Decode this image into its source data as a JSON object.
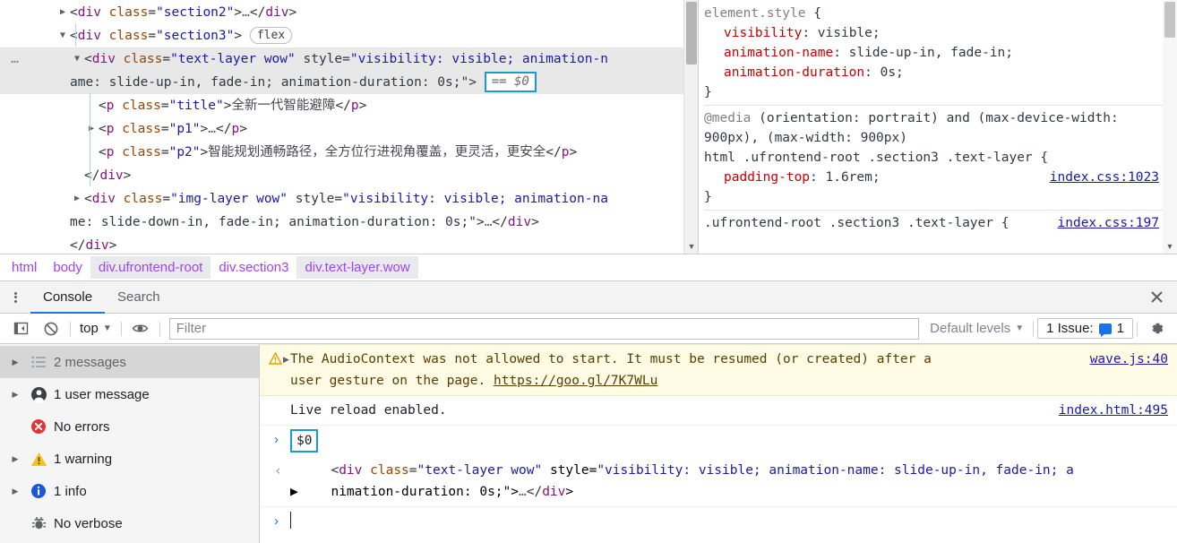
{
  "elements_panel": {
    "dom_tree": [
      {
        "indent": 1,
        "triangle": "collapsed",
        "segments": [
          {
            "t": "pn",
            "v": "<"
          },
          {
            "t": "tw",
            "v": "div"
          },
          {
            "t": "pn",
            "v": " "
          },
          {
            "t": "at",
            "v": "class"
          },
          {
            "t": "pn",
            "v": "="
          },
          {
            "t": "av",
            "v": "\"section2\""
          },
          {
            "t": "pn",
            "v": ">"
          },
          {
            "t": "el",
            "v": "…"
          },
          {
            "t": "pn",
            "v": "</"
          },
          {
            "t": "tw",
            "v": "div"
          },
          {
            "t": "pn",
            "v": ">"
          }
        ]
      },
      {
        "indent": 1,
        "triangle": "expanded",
        "segments": [
          {
            "t": "pn",
            "v": "<"
          },
          {
            "t": "tw",
            "v": "div"
          },
          {
            "t": "pn",
            "v": " "
          },
          {
            "t": "at",
            "v": "class"
          },
          {
            "t": "pn",
            "v": "="
          },
          {
            "t": "av",
            "v": "\"section3\""
          },
          {
            "t": "pn",
            "v": "> "
          }
        ],
        "badge_flex": "flex"
      },
      {
        "indent": 2,
        "triangle": "expanded",
        "selected": true,
        "ellipsis": "…",
        "line1": "<div class=\"text-layer wow\" style=\"visibility: visible; animation-n",
        "line2": "ame: slide-up-in, fade-in; animation-duration: 0s;\">",
        "badge_selected": "== $0"
      },
      {
        "indent": 3,
        "triangle": "none",
        "segments": [
          {
            "t": "pn",
            "v": "<"
          },
          {
            "t": "tw",
            "v": "p"
          },
          {
            "t": "pn",
            "v": " "
          },
          {
            "t": "at",
            "v": "class"
          },
          {
            "t": "pn",
            "v": "="
          },
          {
            "t": "av",
            "v": "\"title\""
          },
          {
            "t": "pn",
            "v": ">"
          },
          {
            "t": "tx",
            "v": "全新一代智能避障"
          },
          {
            "t": "pn",
            "v": "</"
          },
          {
            "t": "tw",
            "v": "p"
          },
          {
            "t": "pn",
            "v": ">"
          }
        ]
      },
      {
        "indent": 3,
        "triangle": "collapsed",
        "segments": [
          {
            "t": "pn",
            "v": "<"
          },
          {
            "t": "tw",
            "v": "p"
          },
          {
            "t": "pn",
            "v": " "
          },
          {
            "t": "at",
            "v": "class"
          },
          {
            "t": "pn",
            "v": "="
          },
          {
            "t": "av",
            "v": "\"p1\""
          },
          {
            "t": "pn",
            "v": ">"
          },
          {
            "t": "el",
            "v": "…"
          },
          {
            "t": "pn",
            "v": "</"
          },
          {
            "t": "tw",
            "v": "p"
          },
          {
            "t": "pn",
            "v": ">"
          }
        ]
      },
      {
        "indent": 3,
        "triangle": "none",
        "segments": [
          {
            "t": "pn",
            "v": "<"
          },
          {
            "t": "tw",
            "v": "p"
          },
          {
            "t": "pn",
            "v": " "
          },
          {
            "t": "at",
            "v": "class"
          },
          {
            "t": "pn",
            "v": "="
          },
          {
            "t": "av",
            "v": "\"p2\""
          },
          {
            "t": "pn",
            "v": ">"
          },
          {
            "t": "tx",
            "v": "智能规划通畅路径，全方位行进视角覆盖，更灵活，更安全"
          },
          {
            "t": "pn",
            "v": "</"
          },
          {
            "t": "tw",
            "v": "p"
          },
          {
            "t": "pn",
            "v": ">"
          }
        ]
      },
      {
        "indent": 2,
        "triangle": "none",
        "segments": [
          {
            "t": "pn",
            "v": "</"
          },
          {
            "t": "tw",
            "v": "div"
          },
          {
            "t": "pn",
            "v": ">"
          }
        ]
      },
      {
        "indent": 2,
        "triangle": "collapsed",
        "two_line": true,
        "line1": "<div class=\"img-layer wow\" style=\"visibility: visible; animation-na",
        "line2": "me: slide-down-in, fade-in; animation-duration: 0s;\">…</div>"
      },
      {
        "indent": 1,
        "triangle": "none",
        "segments": [
          {
            "t": "pn",
            "v": "</"
          },
          {
            "t": "tw",
            "v": "div"
          },
          {
            "t": "pn",
            "v": ">"
          }
        ]
      }
    ],
    "styles": {
      "rules": [
        {
          "selector_gray": "element.style",
          "selector_rest": " {",
          "declarations": [
            {
              "prop": "visibility",
              "value": "visible"
            },
            {
              "prop": "animation-name",
              "value": "slide-up-in, fade-in"
            },
            {
              "prop": "animation-duration",
              "value": "0s"
            }
          ],
          "close": "}",
          "source": ""
        },
        {
          "media_gray": "@media",
          "media_rest": " (orientation: portrait) and (max-device-width: 900px), (max-width: 900px)",
          "selector_rest": "html .ufrontend-root .section3 .text-layer {",
          "declarations": [
            {
              "prop": "padding-top",
              "value": "1.6rem"
            }
          ],
          "close": "}",
          "source": "index.css:1023"
        },
        {
          "selector_rest": ".ufrontend-root .section3 .text-layer {",
          "declarations": [],
          "close": "",
          "source": "index.css:197"
        }
      ]
    },
    "breadcrumb": [
      {
        "label": "html",
        "shaded": false
      },
      {
        "label": "body",
        "shaded": false
      },
      {
        "label": "div.ufrontend-root",
        "shaded": true
      },
      {
        "label": "div.section3",
        "shaded": false
      },
      {
        "label": "div.text-layer.wow",
        "shaded": true
      }
    ]
  },
  "drawer": {
    "tabs": [
      {
        "label": "Console",
        "active": true
      },
      {
        "label": "Search",
        "active": false
      }
    ],
    "close_label": "✕",
    "toolbar": {
      "sidebar_toggle_icon": "sidebar-toggle-icon",
      "clear_icon": "clear-console-icon",
      "context": "top",
      "eye_icon": "live-expression-icon",
      "filter_placeholder": "Filter",
      "levels_label": "Default levels",
      "issues_label": "1 Issue:",
      "issues_count": "1",
      "settings_icon": "gear-icon"
    },
    "sidebar": [
      {
        "label": "2 messages",
        "icon": "list-icon",
        "triangle": true,
        "selected": true
      },
      {
        "label": "1 user message",
        "icon": "person-icon",
        "triangle": true,
        "selected": false
      },
      {
        "label": "No errors",
        "icon": "error-icon",
        "triangle": false,
        "selected": false
      },
      {
        "label": "1 warning",
        "icon": "warning-icon",
        "triangle": true,
        "selected": false
      },
      {
        "label": "1 info",
        "icon": "info-icon",
        "triangle": true,
        "selected": false
      },
      {
        "label": "No verbose",
        "icon": "bug-icon",
        "triangle": false,
        "selected": false
      }
    ],
    "messages": {
      "warning": {
        "text_line1": "The AudioContext was not allowed to start. It must be resumed (or created) after a",
        "text_line2": "user gesture on the page. ",
        "link": "https://goo.gl/7K7WLu",
        "source": "wave.js:40"
      },
      "info": {
        "text": "Live reload enabled.",
        "source": "index.html:495"
      }
    },
    "console_input": {
      "prompt": "›",
      "value": "$0"
    },
    "console_result": {
      "return_arrow": "‹",
      "line1": "<div class=\"text-layer wow\" style=\"visibility: visible; animation-name: slide-up-in, fade-in; a",
      "line2": "nimation-duration: 0s;\">…</div>"
    },
    "console_new_prompt": {
      "prompt": "›",
      "value": ""
    }
  },
  "colors": {
    "accent": "#1a73e8",
    "selection_border": "#1a9ad1",
    "warning_bg": "#fffbe5",
    "tag": "#881280",
    "attr_name": "#994500",
    "attr_value": "#1a1aa6",
    "prop": "#c80000",
    "crumb": "#a142f4"
  }
}
